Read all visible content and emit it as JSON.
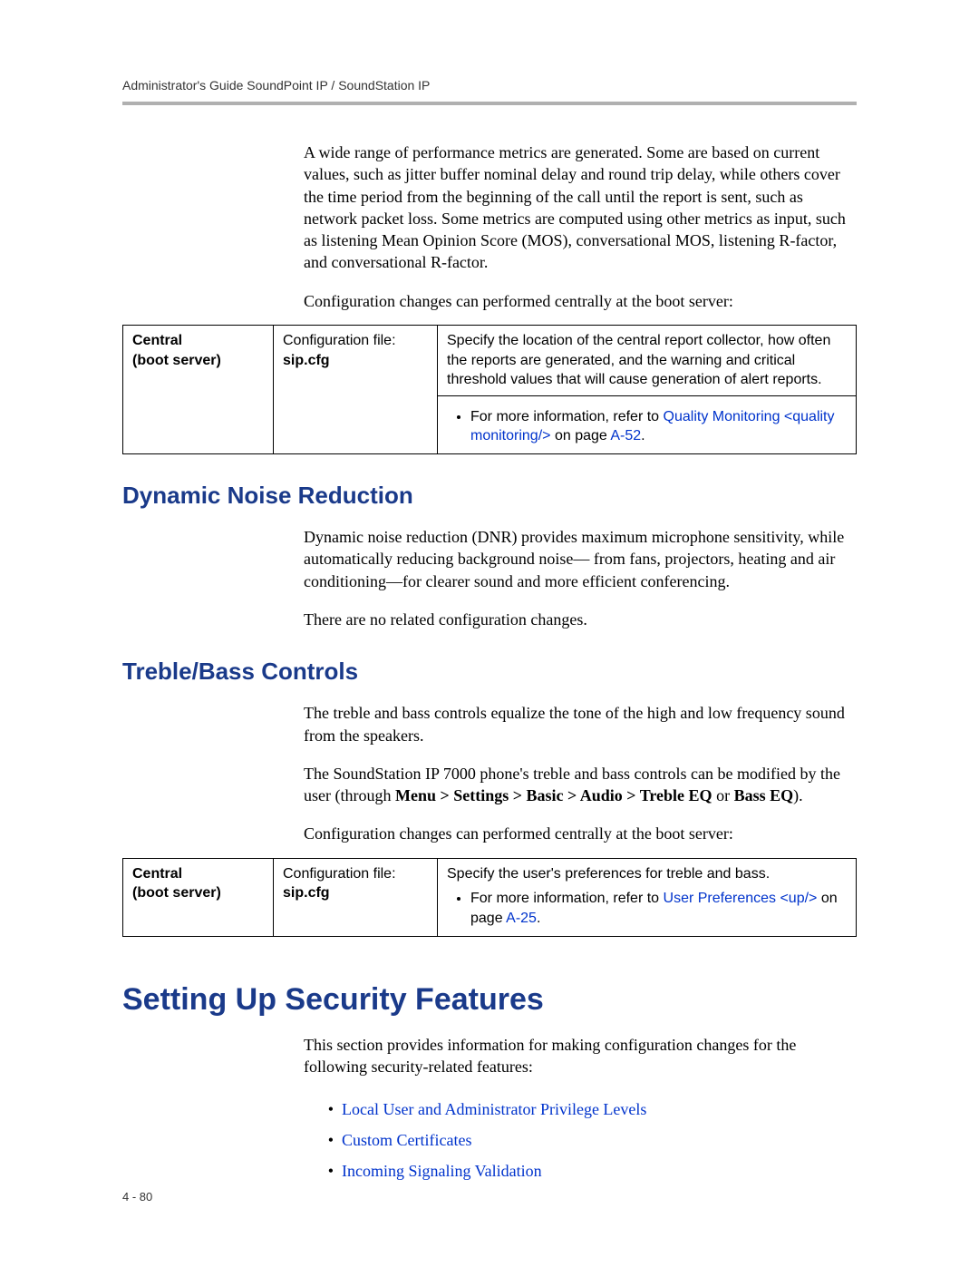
{
  "runningHead": "Administrator's Guide SoundPoint IP / SoundStation IP",
  "intro": {
    "p1": "A wide range of performance metrics are generated. Some are based on current values, such as jitter buffer nominal delay and round trip delay, while others cover the time period from the beginning of the call until the report is sent, such as network packet loss. Some metrics are computed using other metrics as input, such as listening Mean Opinion Score (MOS), conversational MOS, listening R-factor, and conversational R-factor.",
    "p2": "Configuration changes can performed centrally at the boot server:"
  },
  "table1": {
    "c1a": "Central",
    "c1b": "(boot server)",
    "c2a": "Configuration file:",
    "c2b": "sip.cfg",
    "c3": "Specify the location of the central report collector, how often the reports are generated, and the warning and critical threshold values that will cause generation of alert reports.",
    "bulletPrefix": "For more information, refer to ",
    "bulletLink": "Quality Monitoring <quality monitoring/>",
    "bulletMid": " on page ",
    "bulletPage": "A-52",
    "bulletEnd": "."
  },
  "dnr": {
    "heading": "Dynamic Noise Reduction",
    "p1": "Dynamic noise reduction (DNR) provides maximum microphone sensitivity, while automatically reducing background noise—  from fans, projectors, heating and air conditioning—for clearer sound and more efficient conferencing.",
    "p2": "There are no related configuration changes."
  },
  "tb": {
    "heading": "Treble/Bass Controls",
    "p1": "The treble and bass controls equalize the tone of the high and low frequency sound from the speakers.",
    "p2a": "The SoundStation IP 7000 phone's treble and bass controls can be modified by the user (through ",
    "p2b": "Menu > Settings > Basic > Audio > Treble EQ",
    "p2c": " or ",
    "p2d": "Bass EQ",
    "p2e": ").",
    "p3": "Configuration changes can performed centrally at the boot server:"
  },
  "table2": {
    "c1a": "Central",
    "c1b": "(boot server)",
    "c2a": "Configuration file:",
    "c2b": "sip.cfg",
    "c3": "Specify the user's preferences for treble and bass.",
    "bulletPrefix": "For more information, refer to ",
    "bulletLink": "User Preferences <up/>",
    "bulletMid": " on page ",
    "bulletPage": "A-25",
    "bulletEnd": "."
  },
  "sec": {
    "heading": "Setting Up Security Features",
    "p1": "This section provides information for making configuration changes for the following security-related features:",
    "items": [
      "Local User and Administrator Privilege Levels",
      "Custom Certificates",
      "Incoming Signaling Validation"
    ]
  },
  "pageNum": "4 - 80"
}
